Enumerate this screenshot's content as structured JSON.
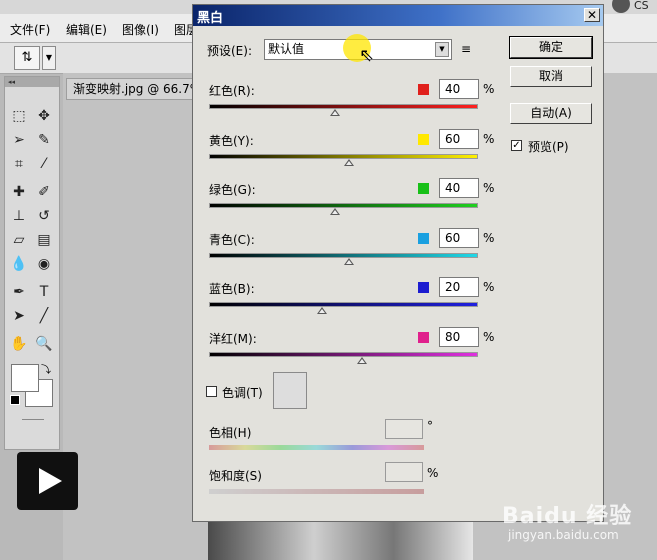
{
  "app": {
    "menu": [
      "文件(F)",
      "编辑(E)",
      "图像(I)",
      "图层"
    ],
    "document_tab": "渐变映射.jpg @ 66.7%",
    "corner_text": "CS"
  },
  "dialog": {
    "title": "黑白",
    "close_glyph": "✕",
    "preset": {
      "label": "预设(E):",
      "value": "默认值",
      "menu_glyph": "≡"
    },
    "buttons": {
      "ok": "确定",
      "cancel": "取消",
      "auto": "自动(A)"
    },
    "preview": {
      "label": "预览(P)",
      "checked": true,
      "check_glyph": "✓"
    },
    "channels": [
      {
        "label": "红色(R):",
        "value": "40",
        "unit": "%",
        "color": "#e0201c",
        "gradient": [
          "#000000",
          "#ff2020"
        ],
        "level": 0.47
      },
      {
        "label": "黄色(Y):",
        "value": "60",
        "unit": "%",
        "color": "#ffe800",
        "gradient": [
          "#000000",
          "#fff000"
        ],
        "level": 0.52
      },
      {
        "label": "绿色(G):",
        "value": "40",
        "unit": "%",
        "color": "#18c018",
        "gradient": [
          "#000000",
          "#20d020"
        ],
        "level": 0.47
      },
      {
        "label": "青色(C):",
        "value": "60",
        "unit": "%",
        "color": "#1aa0e0",
        "gradient": [
          "#000000",
          "#20d8e8"
        ],
        "level": 0.52
      },
      {
        "label": "蓝色(B):",
        "value": "20",
        "unit": "%",
        "color": "#1c1cd0",
        "gradient": [
          "#000000",
          "#2020e0"
        ],
        "level": 0.42
      },
      {
        "label": "洋红(M):",
        "value": "80",
        "unit": "%",
        "color": "#e0208c",
        "gradient": [
          "#000000",
          "#e030e0"
        ],
        "level": 0.57
      }
    ],
    "tint": {
      "label": "色调(T)",
      "checked": false
    },
    "hue": {
      "label": "色相(H)",
      "unit": "°"
    },
    "saturation": {
      "label": "饱和度(S)",
      "unit": "%"
    }
  },
  "watermark": {
    "main": "Baidu 经验",
    "sub": "jingyan.baidu.com"
  }
}
